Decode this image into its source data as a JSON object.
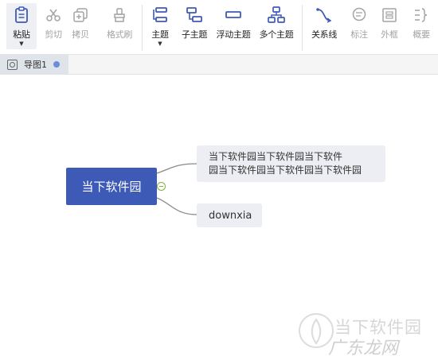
{
  "toolbar": {
    "paste": "粘贴",
    "cut": "剪切",
    "copy": "拷贝",
    "format_painter": "格式刷",
    "topic": "主题",
    "subtopic": "子主题",
    "floating_topic": "浮动主题",
    "multi_topic": "多个主题",
    "relationship": "关系线",
    "label": "标注",
    "boundary": "外框",
    "summary": "概要"
  },
  "tabs": [
    {
      "label": "导图1"
    }
  ],
  "mindmap": {
    "central": "当下软件园",
    "subtopic1_line1": "当下软件园当下软件园当下软件",
    "subtopic1_line2": "园当下软件园当下软件园当下软件园",
    "subtopic2": "downxia"
  },
  "watermark": {
    "text1": "当下软件园",
    "text2": "广东龙网"
  },
  "colors": {
    "central_fill": "#3e5ab7",
    "subtopic_fill": "#eceef3",
    "icon_blue": "#3e5ab7",
    "unsaved_dot": "#6b8ddc"
  }
}
